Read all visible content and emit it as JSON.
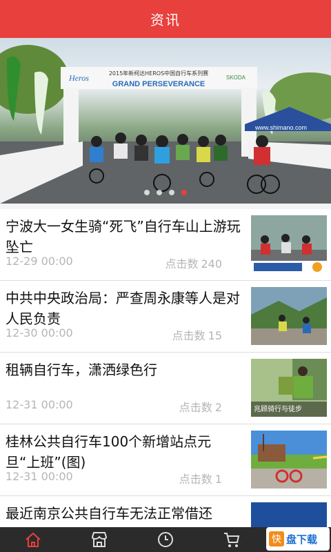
{
  "header": {
    "title": "资讯"
  },
  "banner": {
    "arch_lines": [
      "2015年新柯达HEROS中国自行车系列赛",
      "GRAND PERSEVERANCE"
    ],
    "brand_heros": "Heros",
    "brand_skoda": "SKODA",
    "shimano_url": "www.shimano.com",
    "slides": 4,
    "active_slide": 4
  },
  "news": [
    {
      "title": "宁波大一女生骑“死飞”自行车山上游玩坠亡",
      "date": "12-29 00:00",
      "clicks_label": "点击数",
      "clicks": "240",
      "thumb_caption": ""
    },
    {
      "title": "中共中央政治局：严查周永康等人是对人民负责",
      "date": "12-30 00:00",
      "clicks_label": "点击数",
      "clicks": "15",
      "thumb_caption": ""
    },
    {
      "title": "租辆自行车，潇洒绿色行",
      "date": "12-31 00:00",
      "clicks_label": "点击数",
      "clicks": "2",
      "thumb_caption": "兆顾骑行与徒步"
    },
    {
      "title": "桂林公共自行车100个新增站点元旦“上班”(图)",
      "date": "12-31 00:00",
      "clicks_label": "点击数",
      "clicks": "1",
      "thumb_caption": ""
    },
    {
      "title": "最近南京公共自行车无法正常借还",
      "date": "",
      "clicks_label": "",
      "clicks": "",
      "thumb_caption": ""
    }
  ],
  "tabbar": {
    "icons": [
      "home-icon",
      "store-icon",
      "clock-icon",
      "cart-icon",
      "more-icon"
    ]
  },
  "watermark": {
    "badge": "快",
    "text": "盘下载"
  },
  "colors": {
    "accent": "#e8403d",
    "tabbar": "#2b2b2b"
  }
}
